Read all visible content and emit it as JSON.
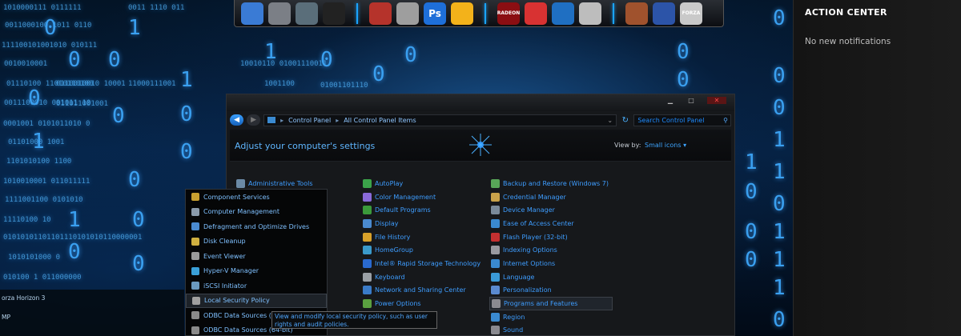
{
  "dock": {
    "items": [
      {
        "icon": "monitor-icon",
        "color": "#3a7bd5"
      },
      {
        "icon": "door-icon",
        "color": "#7b7f86"
      },
      {
        "icon": "printer-icon",
        "color": "#5a6e7a"
      },
      {
        "icon": "speedometer-icon",
        "color": "#222"
      },
      {
        "icon": "browser-icon",
        "color": "#b5332b"
      },
      {
        "icon": "hammer-icon",
        "color": "#9e9e9e"
      },
      {
        "icon": "photoshop-icon",
        "color": "#1e6fd9",
        "label": "Ps"
      },
      {
        "icon": "sticky-notes-icon",
        "color": "#f3b21a"
      },
      {
        "icon": "radeon-icon",
        "color": "#8b0e12",
        "label": "RADEON"
      },
      {
        "icon": "package-icon",
        "color": "#d83232"
      },
      {
        "icon": "screen-capture-icon",
        "color": "#1f6fc2"
      },
      {
        "icon": "camera-icon",
        "color": "#bdbdbd"
      },
      {
        "icon": "game-warrior-icon",
        "color": "#a0522d"
      },
      {
        "icon": "game-car-icon",
        "color": "#2c54a8"
      },
      {
        "icon": "forza-icon",
        "color": "#c9c9c9",
        "label": "FORZA"
      }
    ]
  },
  "action_center": {
    "title": "ACTION CENTER",
    "message": "No new notifications"
  },
  "window": {
    "address": {
      "root": "Control Panel",
      "current": "All Control Panel Items"
    },
    "search_placeholder": "Search Control Panel",
    "heading": "Adjust your computer's settings",
    "view_by_label": "View by:",
    "view_by_value": "Small icons",
    "columns": [
      [
        {
          "label": "Administrative Tools",
          "color": "#6b8aa6"
        },
        {
          "label": "",
          "color": "transparent"
        },
        {
          "label": "",
          "color": "transparent"
        },
        {
          "label": "",
          "color": "transparent"
        },
        {
          "label": "",
          "color": "transparent"
        },
        {
          "label": "",
          "color": "transparent"
        },
        {
          "label": "",
          "color": "transparent"
        },
        {
          "label": "",
          "color": "transparent"
        },
        {
          "label": "",
          "color": "transparent"
        },
        {
          "label": "",
          "color": "transparent"
        },
        {
          "label": "",
          "color": "transparent"
        },
        {
          "label": "",
          "color": "transparent"
        }
      ],
      [
        {
          "label": "AutoPlay",
          "color": "#3ba34a"
        },
        {
          "label": "Color Management",
          "color": "#8a6ad9"
        },
        {
          "label": "Default Programs",
          "color": "#3b9a3b"
        },
        {
          "label": "Display",
          "color": "#4a8ad0"
        },
        {
          "label": "File History",
          "color": "#d8a12a"
        },
        {
          "label": "HomeGroup",
          "color": "#3b9acb"
        },
        {
          "label": "Intel® Rapid Storage Technology",
          "color": "#2a6ad0"
        },
        {
          "label": "Keyboard",
          "color": "#9aa0a6"
        },
        {
          "label": "Network and Sharing Center",
          "color": "#3a7bc8"
        },
        {
          "label": "Power Options",
          "color": "#5aa040"
        },
        {
          "label": "",
          "color": "transparent"
        },
        {
          "label": "",
          "color": "transparent"
        }
      ],
      [
        {
          "label": "Backup and Restore (Windows 7)",
          "color": "#58a658"
        },
        {
          "label": "Credential Manager",
          "color": "#c9a24a"
        },
        {
          "label": "Device Manager",
          "color": "#7a8a9a"
        },
        {
          "label": "Ease of Access Center",
          "color": "#3a8ad0"
        },
        {
          "label": "Flash Player (32-bit)",
          "color": "#c43030"
        },
        {
          "label": "Indexing Options",
          "color": "#9a9aa0"
        },
        {
          "label": "Internet Options",
          "color": "#3a8ad0"
        },
        {
          "label": "Language",
          "color": "#3a9ad8"
        },
        {
          "label": "Personalization",
          "color": "#5a8ad0"
        },
        {
          "label": "Programs and Features",
          "color": "#8a8a90"
        },
        {
          "label": "Region",
          "color": "#3a8ad0"
        },
        {
          "label": "Sound",
          "color": "#8a8a90"
        }
      ]
    ]
  },
  "admin_menu": {
    "items": [
      {
        "label": "Component Services",
        "color": "#c9a030"
      },
      {
        "label": "Computer Management",
        "color": "#8a9aaa"
      },
      {
        "label": "Defragment and Optimize Drives",
        "color": "#4a8ad0"
      },
      {
        "label": "Disk Cleanup",
        "color": "#d0b040"
      },
      {
        "label": "Event Viewer",
        "color": "#9a9a9a"
      },
      {
        "label": "Hyper-V Manager",
        "color": "#3aa0d8"
      },
      {
        "label": "iSCSI Initiator",
        "color": "#6a9ac0"
      },
      {
        "label": "Local Security Policy",
        "color": "#a0a0a0"
      },
      {
        "label": "ODBC Data Sources (32-",
        "color": "#8a8a8a"
      },
      {
        "label": "ODBC Data Sources (64-bit)",
        "color": "#8a8a8a"
      }
    ],
    "active_index": 7
  },
  "tooltip": {
    "text": "View and modify local security policy, such as user rights and audit policies."
  },
  "left_strip": {
    "line1": "orza Horizon 3",
    "line2": "MP"
  }
}
